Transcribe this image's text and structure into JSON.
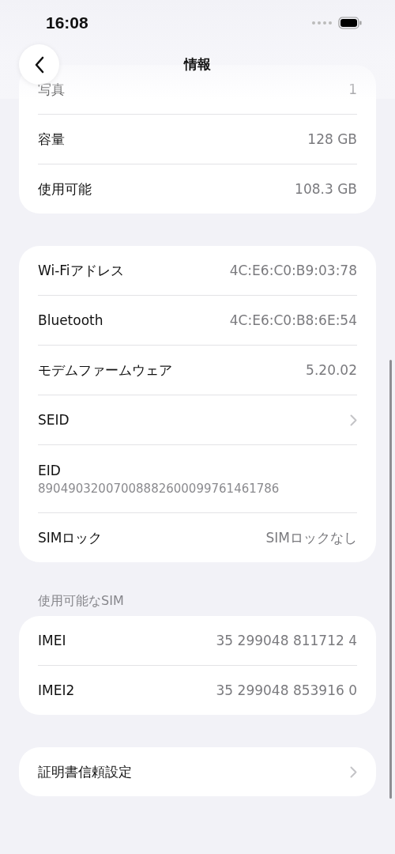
{
  "status_bar": {
    "time": "16:08"
  },
  "nav": {
    "title": "情報"
  },
  "sections": [
    {
      "rows": [
        {
          "kind": "value",
          "label": "写真",
          "value": "1"
        },
        {
          "kind": "value",
          "label": "容量",
          "value": "128 GB"
        },
        {
          "kind": "value",
          "label": "使用可能",
          "value": "108.3 GB"
        }
      ]
    },
    {
      "rows": [
        {
          "kind": "value",
          "label": "Wi-Fiアドレス",
          "value": "4C:E6:C0:B9:03:78"
        },
        {
          "kind": "value",
          "label": "Bluetooth",
          "value": "4C:E6:C0:B8:6E:54"
        },
        {
          "kind": "value",
          "label": "モデムファームウェア",
          "value": "5.20.02"
        },
        {
          "kind": "chevron",
          "label": "SEID"
        },
        {
          "kind": "stacked",
          "label": "EID",
          "value": "89049032007008882600099761461786"
        },
        {
          "kind": "value",
          "label": "SIMロック",
          "value": "SIMロックなし"
        }
      ]
    },
    {
      "header": "使用可能なSIM",
      "rows": [
        {
          "kind": "value",
          "label": "IMEI",
          "value": "35 299048 811712 4"
        },
        {
          "kind": "value",
          "label": "IMEI2",
          "value": "35 299048 853916 0"
        }
      ]
    },
    {
      "rows": [
        {
          "kind": "chevron",
          "label": "証明書信頼設定"
        }
      ]
    }
  ]
}
